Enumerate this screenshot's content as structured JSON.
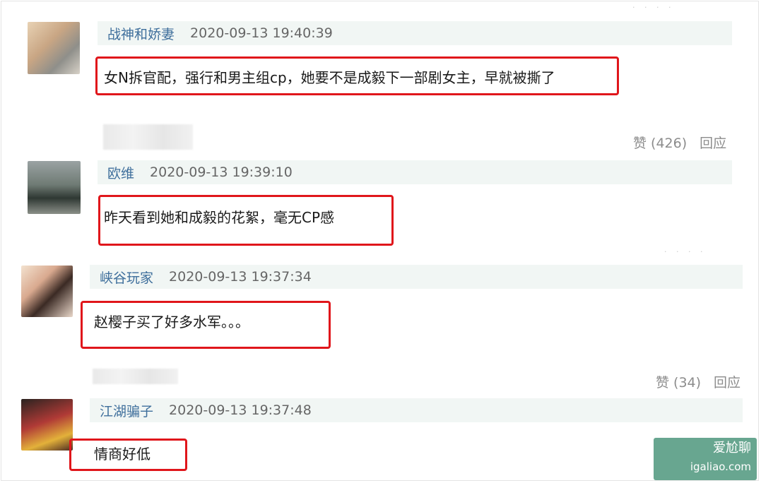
{
  "comments": [
    {
      "username": "战神和娇妻",
      "time": "2020-09-13 19:40:39",
      "text": "女N拆官配，强行和男主组cp，她要不是成毅下一部剧女主，早就被撕了"
    },
    {
      "username": "欧维",
      "time": "2020-09-13 19:39:10",
      "text": "昨天看到她和成毅的花絮，毫无CP感"
    },
    {
      "username": "峡谷玩家",
      "time": "2020-09-13 19:37:34",
      "text": "赵樱子买了好多水军。。。"
    },
    {
      "username": "江湖骗子",
      "time": "2020-09-13 19:37:48",
      "text": "情商好低"
    }
  ],
  "actions": [
    {
      "like": "赞 (426)",
      "reply": "回应"
    },
    {
      "like": "赞 (34)",
      "reply": "回应"
    }
  ],
  "dots": "· · · ·",
  "watermark": {
    "line1": "爱尬聊",
    "line2": "igaliao.com"
  },
  "colors": {
    "highlight": "#e0161b",
    "username": "#3f6f9c",
    "header_bg": "#f1f6f4"
  }
}
